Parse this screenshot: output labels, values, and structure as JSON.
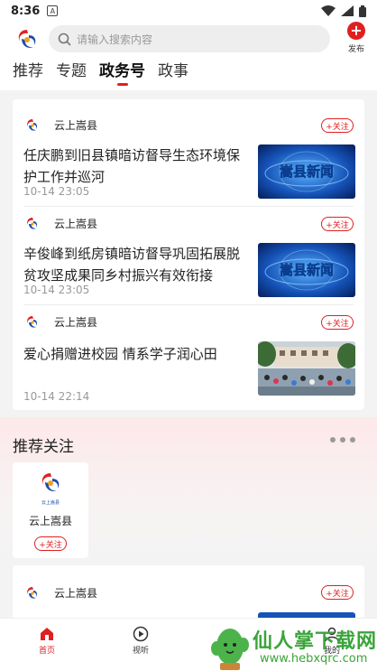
{
  "status_bar": {
    "time": "8:36",
    "a_badge": "A"
  },
  "header": {
    "search_placeholder": "请输入搜索内容",
    "publish_label": "发布",
    "tabs": [
      {
        "label": "推荐",
        "active": false
      },
      {
        "label": "专题",
        "active": false
      },
      {
        "label": "政务号",
        "active": true
      },
      {
        "label": "政事",
        "active": false
      }
    ]
  },
  "feed": {
    "items": [
      {
        "source": "云上嵩县",
        "follow": "+关注",
        "title": "任庆鹏到旧县镇暗访督导生态环境保护工作并巡河",
        "time": "10-14 23:05",
        "thumb_text": "嵩县新闻"
      },
      {
        "source": "云上嵩县",
        "follow": "+关注",
        "title": "辛俊峰到纸房镇暗访督导巩固拓展脱贫攻坚成果同乡村振兴有效衔接",
        "time": "10-14 23:05",
        "thumb_text": "嵩县新闻"
      },
      {
        "source": "云上嵩县",
        "follow": "+关注",
        "title": "爱心捐赠进校园 情系学子润心田",
        "time": "10-14 22:14"
      }
    ]
  },
  "recommend": {
    "title": "推荐关注",
    "account": {
      "name": "云上嵩县",
      "logo_caption": "云上嵩县",
      "follow": "+关注"
    }
  },
  "feed2": {
    "source": "云上嵩县",
    "follow": "+关注"
  },
  "bottom_nav": [
    {
      "label": "首页",
      "icon": "home-icon",
      "active": true
    },
    {
      "label": "视听",
      "icon": "play-icon",
      "active": false
    },
    {
      "label": "我的",
      "icon": "user-icon",
      "active": false
    }
  ],
  "watermark": {
    "title": "仙人掌下载网",
    "url": "www.hebxqrc.com"
  },
  "colors": {
    "accent": "#e02020",
    "watermark": "#3aa43a"
  }
}
